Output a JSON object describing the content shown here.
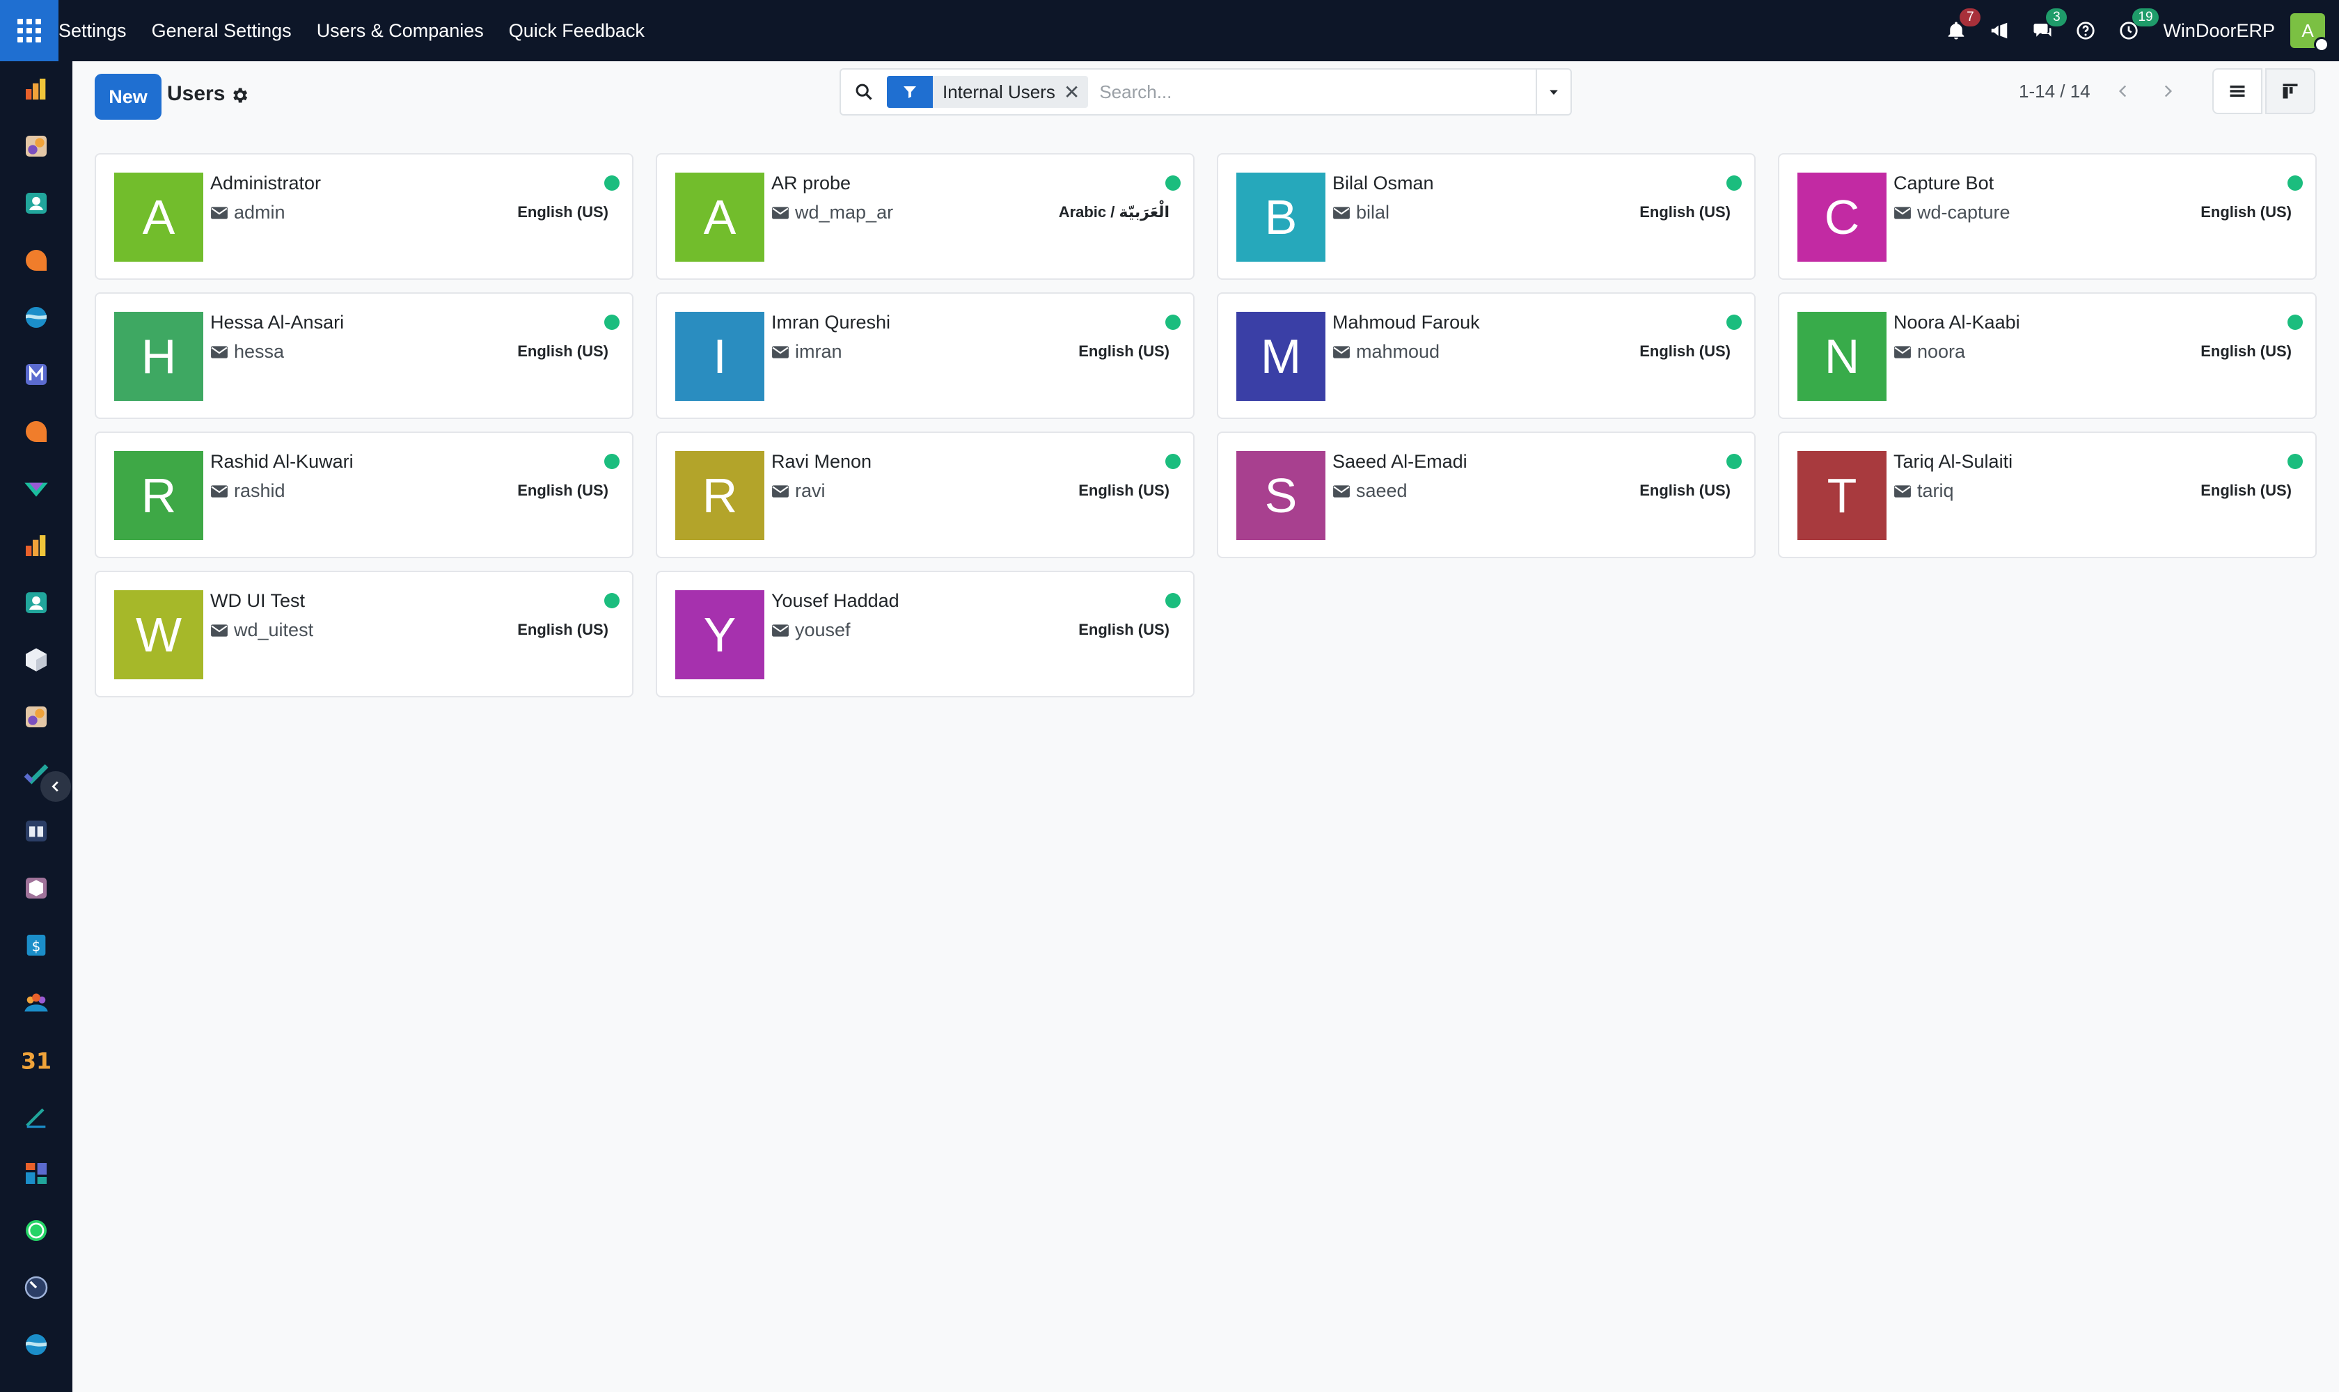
{
  "topbar": {
    "menu": [
      "Settings",
      "General Settings",
      "Users & Companies",
      "Quick Feedback"
    ],
    "notifications_count": "7",
    "messages_count": "3",
    "activities_count": "19",
    "company": "WinDoorERP",
    "user_initial": "A"
  },
  "sidebar": {
    "apps": [
      "inventory-app-icon",
      "studio-app-icon",
      "contacts-app-icon",
      "discuss-app-icon",
      "website-app-icon",
      "email-marketing-app-icon",
      "livechat-app-icon",
      "vendor-app-icon",
      "reporting-app-icon",
      "employees-app-icon",
      "products-app-icon",
      "studio2-app-icon",
      "project-app-icon",
      "knowledge-app-icon",
      "package-app-icon",
      "invoicing-app-icon",
      "team-app-icon",
      "calendar-app-icon",
      "sign-app-icon",
      "dashboard-app-icon",
      "whatsapp-app-icon",
      "timer-app-icon",
      "website2-app-icon"
    ]
  },
  "control": {
    "new_label": "New",
    "title": "Users",
    "facet": "Internal Users",
    "facet_remove": "✕",
    "search_placeholder": "Search...",
    "pager": "1-14 / 14"
  },
  "users": [
    {
      "initial": "A",
      "color": "#72bd2c",
      "name": "Administrator",
      "login": "admin",
      "lang": "English (US)"
    },
    {
      "initial": "A",
      "color": "#72bd2c",
      "name": "AR probe",
      "login": "wd_map_ar",
      "lang": "Arabic / الْعَرَبيّة"
    },
    {
      "initial": "B",
      "color": "#26a8bb",
      "name": "Bilal Osman",
      "login": "bilal",
      "lang": "English (US)"
    },
    {
      "initial": "C",
      "color": "#c22aa3",
      "name": "Capture Bot",
      "login": "wd-capture",
      "lang": "English (US)"
    },
    {
      "initial": "H",
      "color": "#3ea862",
      "name": "Hessa Al-Ansari",
      "login": "hessa",
      "lang": "English (US)"
    },
    {
      "initial": "I",
      "color": "#2a8dc0",
      "name": "Imran Qureshi",
      "login": "imran",
      "lang": "English (US)"
    },
    {
      "initial": "M",
      "color": "#3a3fa6",
      "name": "Mahmoud Farouk",
      "login": "mahmoud",
      "lang": "English (US)"
    },
    {
      "initial": "N",
      "color": "#38ab4a",
      "name": "Noora Al-Kaabi",
      "login": "noora",
      "lang": "English (US)"
    },
    {
      "initial": "R",
      "color": "#3ea846",
      "name": "Rashid Al-Kuwari",
      "login": "rashid",
      "lang": "English (US)"
    },
    {
      "initial": "R",
      "color": "#b3a42a",
      "name": "Ravi Menon",
      "login": "ravi",
      "lang": "English (US)"
    },
    {
      "initial": "S",
      "color": "#a8408f",
      "name": "Saeed Al-Emadi",
      "login": "saeed",
      "lang": "English (US)"
    },
    {
      "initial": "T",
      "color": "#a83a3e",
      "name": "Tariq Al-Sulaiti",
      "login": "tariq",
      "lang": "English (US)"
    },
    {
      "initial": "W",
      "color": "#a6b829",
      "name": "WD UI Test",
      "login": "wd_uitest",
      "lang": "English (US)"
    },
    {
      "initial": "Y",
      "color": "#a631ae",
      "name": "Yousef Haddad",
      "login": "yousef",
      "lang": "English (US)"
    }
  ]
}
